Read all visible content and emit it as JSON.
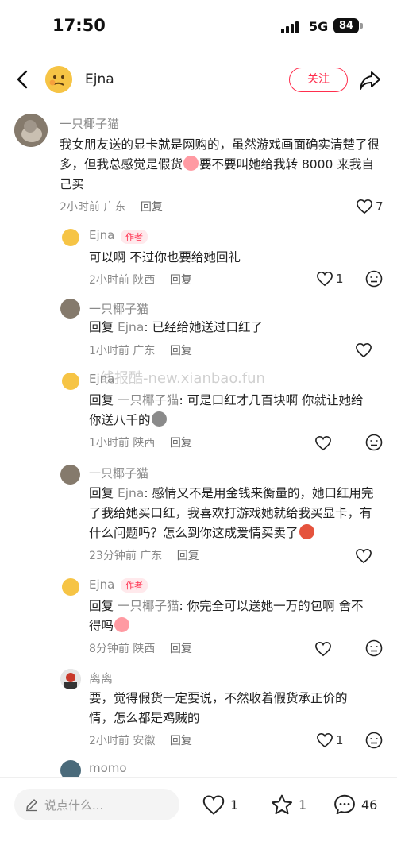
{
  "status_bar": {
    "time": "17:50",
    "network": "5G",
    "battery": "84"
  },
  "header": {
    "author": "Ejna",
    "follow_label": "关注",
    "icons": [
      "back-arrow-icon",
      "share-icon"
    ]
  },
  "comments": [
    {
      "name": "一只椰子猫",
      "text_before": "我女朋友送的显卡就是网购的，虽然游戏画面确实清楚了很多，但我总感觉是假货",
      "emoji": "pig-face-emoji",
      "text_after": "要不要叫她给我转 8000 来我自己买",
      "time": "2小时前",
      "location": "广东",
      "reply_label": "回复",
      "likes": "7"
    }
  ],
  "replies": [
    {
      "name": "Ejna",
      "is_author": true,
      "author_label": "作者",
      "text": "可以啊 不过你也要给她回礼",
      "time": "2小时前",
      "location": "陕西",
      "reply_label": "回复",
      "likes": "1"
    },
    {
      "name": "一只椰子猫",
      "is_author": false,
      "reply_prefix": "回复",
      "reply_to": "Ejna",
      "text": ": 已经给她送过口红了",
      "time": "1小时前",
      "location": "广东",
      "reply_label": "回复",
      "likes": ""
    },
    {
      "name": "Ejna",
      "is_author": true,
      "author_label": "作者",
      "reply_prefix": "回复",
      "reply_to": "一只椰子猫",
      "text": ": 可是口红才几百块啊 你就让她给你送八千的",
      "emoji": "poop-emoji",
      "time": "1小时前",
      "location": "陕西",
      "reply_label": "回复",
      "likes": ""
    },
    {
      "name": "一只椰子猫",
      "is_author": false,
      "reply_prefix": "回复",
      "reply_to": "Ejna",
      "text": ": 感情又不是用金钱来衡量的，她口红用完了我给她买口红，我喜欢打游戏她就给我买显卡，有什么问题吗？怎么到你这成爱情买卖了",
      "emoji": "angry-face-emoji",
      "time": "23分钟前",
      "location": "广东",
      "reply_label": "回复",
      "likes": ""
    },
    {
      "name": "Ejna",
      "is_author": true,
      "author_label": "作者",
      "reply_prefix": "回复",
      "reply_to": "一只椰子猫",
      "text": ": 你完全可以送她一万的包啊 舍不得吗",
      "emoji": "crying-face-emoji",
      "time": "8分钟前",
      "location": "陕西",
      "reply_label": "回复",
      "likes": ""
    }
  ],
  "second_comment": {
    "name": "离离",
    "text": "要，觉得假货一定要说，不然收着假货承正价的情，怎么都是鸡贼的",
    "time": "2小时前",
    "location": "安徽",
    "reply_label": "回复",
    "likes": "1"
  },
  "third_comment": {
    "name": "momo"
  },
  "watermark": "线报酷-new.xianbao.fun",
  "bottom_bar": {
    "placeholder": "说点什么...",
    "likes": "1",
    "favorites": "1",
    "comments": "46"
  },
  "colors": {
    "accent": "#ff2e4d",
    "muted": "#8a8a8a",
    "text": "#222222"
  }
}
